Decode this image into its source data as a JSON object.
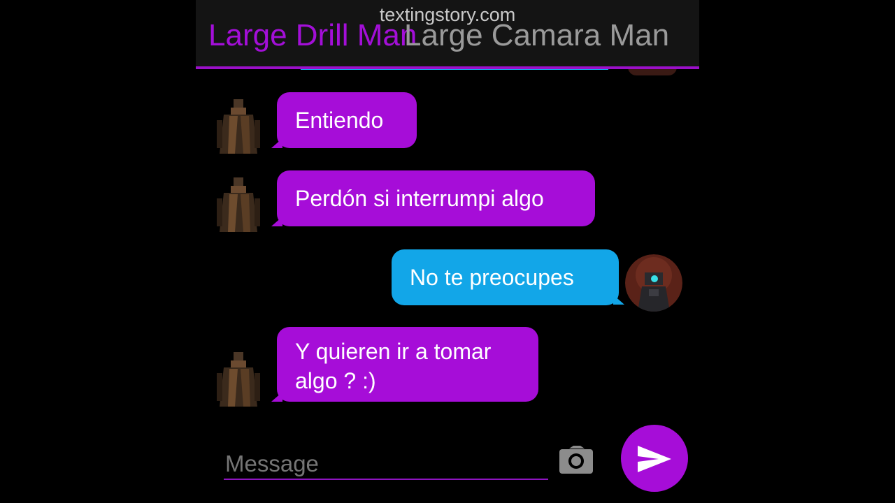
{
  "watermark": "textingstory.com",
  "header": {
    "title_left": "Large Drill Man",
    "title_right": "Large Camara Man"
  },
  "messages": [
    {
      "side": "left",
      "text": "Entiendo",
      "color": "#a60dd8"
    },
    {
      "side": "left",
      "text": "Perdón si interrumpi algo",
      "color": "#a60dd8"
    },
    {
      "side": "right",
      "text": "No te preocupes",
      "color": "#12a6e8"
    },
    {
      "side": "left",
      "text": "Y quieren ir a tomar algo ? :)",
      "color": "#a60dd8"
    }
  ],
  "composer": {
    "placeholder": "Message",
    "camera_icon": "camera-icon",
    "send_icon": "send-icon"
  },
  "colors": {
    "accent": "#a60dd8",
    "outgoing": "#12a6e8",
    "header_bg": "#141414"
  }
}
